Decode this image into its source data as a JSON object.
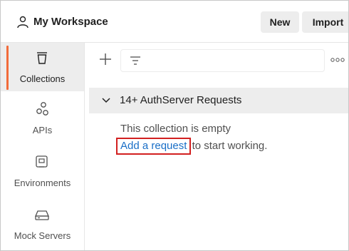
{
  "header": {
    "workspace_icon": "user-icon",
    "title": "My Workspace",
    "new_label": "New",
    "import_label": "Import"
  },
  "sidebar": {
    "items": [
      {
        "label": "Collections",
        "icon": "trash-can-icon",
        "active": true
      },
      {
        "label": "APIs",
        "icon": "nodes-icon",
        "active": false
      },
      {
        "label": "Environments",
        "icon": "environment-box-icon",
        "active": false
      },
      {
        "label": "Mock Servers",
        "icon": "server-icon",
        "active": false
      }
    ]
  },
  "toolbar": {
    "add_icon": "plus-icon",
    "filter_icon": "filter-icon",
    "more_icon": "more-horizontal-icon"
  },
  "collection": {
    "expand_icon": "chevron-down-icon",
    "name": "14+ AuthServer Requests",
    "empty_text": "This collection is empty",
    "add_link": "Add a request",
    "add_suffix": " to start working."
  },
  "colors": {
    "accent": "#f26b3a",
    "link": "#1a6fc7",
    "highlight_box": "#d22020",
    "active_bg": "#ededed"
  }
}
